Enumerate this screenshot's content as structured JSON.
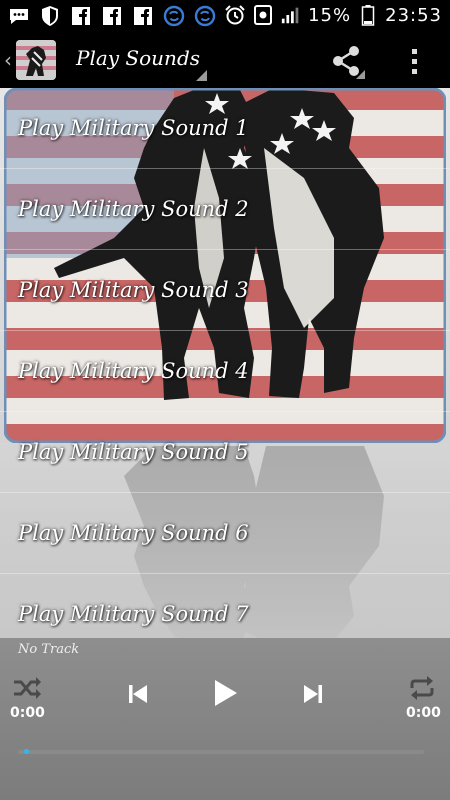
{
  "status_bar": {
    "battery_percent": "15%",
    "time": "23:53",
    "icons": [
      "chat-icon",
      "shield-icon",
      "facebook-icon",
      "facebook-icon",
      "facebook-icon",
      "sync-icon",
      "sync-icon",
      "alarm-icon",
      "photo-icon",
      "signal-icon",
      "battery-icon"
    ]
  },
  "action_bar": {
    "title": "Play Sounds",
    "icons": [
      "back-chevron-icon",
      "app-logo",
      "share-icon",
      "overflow-menu-icon"
    ]
  },
  "tracks": [
    {
      "label": "Play Military Sound 1"
    },
    {
      "label": "Play Military Sound 2"
    },
    {
      "label": "Play Military Sound 3"
    },
    {
      "label": "Play Military Sound 4"
    },
    {
      "label": "Play Military Sound 5"
    },
    {
      "label": "Play Military Sound 6"
    },
    {
      "label": "Play Military Sound 7"
    }
  ],
  "player": {
    "now_playing": "No Track",
    "elapsed_time": "0:00",
    "total_time": "0:00",
    "progress": 0.0,
    "icons": [
      "shuffle-icon",
      "previous-icon",
      "play-icon",
      "next-icon",
      "repeat-icon"
    ]
  },
  "colors": {
    "background": "#000000",
    "seek_accent": "#2db8f0",
    "flag_red": "#b8484a"
  }
}
